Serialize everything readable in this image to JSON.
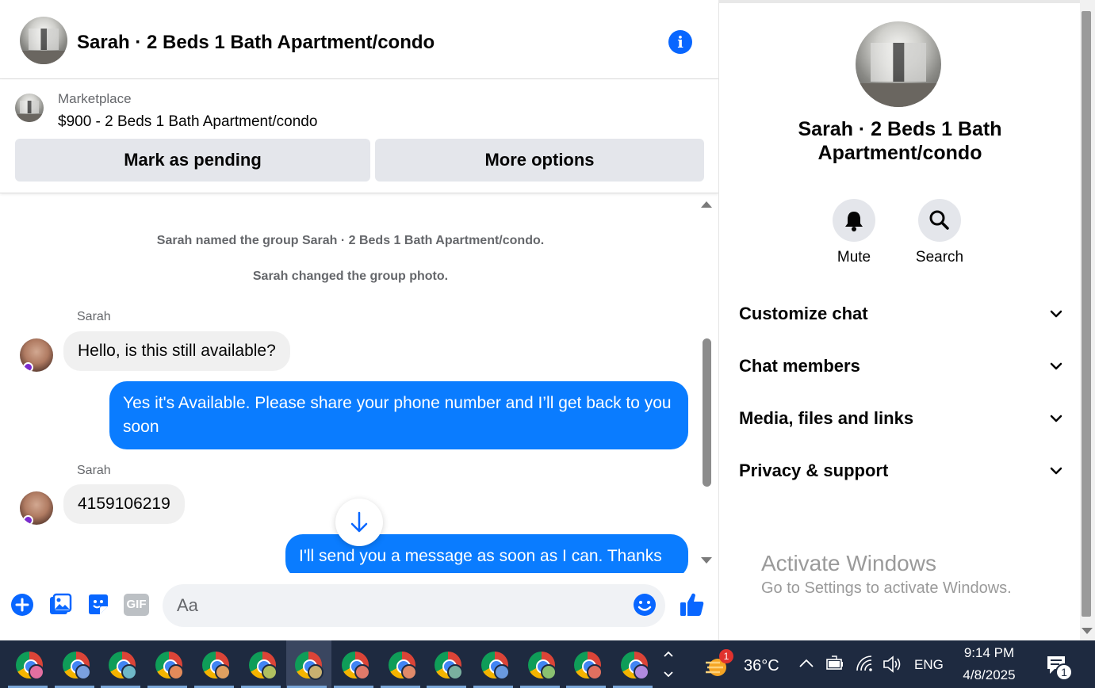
{
  "header": {
    "title": "Sarah · 2 Beds 1 Bath Apartment/condo",
    "info_icon": "i"
  },
  "marketplace": {
    "label": "Marketplace",
    "listing": "$900 - 2 Beds 1 Bath Apartment/condo",
    "mark_pending": "Mark as pending",
    "more_options": "More options"
  },
  "messages": {
    "system_1": "Sarah named the group Sarah · 2 Beds 1 Bath Apartment/condo.",
    "system_2": "Sarah changed the group photo.",
    "sender_1": "Sarah",
    "incoming_1": "Hello, is this still available?",
    "outgoing_1": "Yes it's Available. Please share your phone number and I’ll get back to you soon",
    "sender_2": "Sarah",
    "incoming_2": "4159106219",
    "outgoing_2": "I'll send you a message as soon as I can. Thanks"
  },
  "composer": {
    "placeholder": "Aa",
    "gif_label": "GIF"
  },
  "sidebar": {
    "title": "Sarah · 2 Beds 1 Bath Apartment/condo",
    "mute_label": "Mute",
    "search_label": "Search",
    "sections": [
      "Customize chat",
      "Chat members",
      "Media, files and links",
      "Privacy & support"
    ]
  },
  "watermark": {
    "line1": "Activate Windows",
    "line2": "Go to Settings to activate Windows."
  },
  "taskbar": {
    "weather_badge": "1",
    "temperature": "36°C",
    "language": "ENG",
    "time": "9:14 PM",
    "date": "4/8/2025",
    "notification_count": "1",
    "app_profile_colors": [
      "#e36fa0",
      "#7aa0e0",
      "#6fb8c8",
      "#e38a5a",
      "#e0a060",
      "#b0c060",
      "#c8b070",
      "#e07a6a",
      "#e08a6a",
      "#7ab0a0",
      "#6a9ae0",
      "#8ac070",
      "#e07060",
      "#b08ae0"
    ]
  },
  "colors": {
    "accent_blue": "#0866ff",
    "outgoing_bubble": "#0a7cff",
    "incoming_bubble": "#f0f0f0",
    "taskbar": "#1e2a40"
  }
}
